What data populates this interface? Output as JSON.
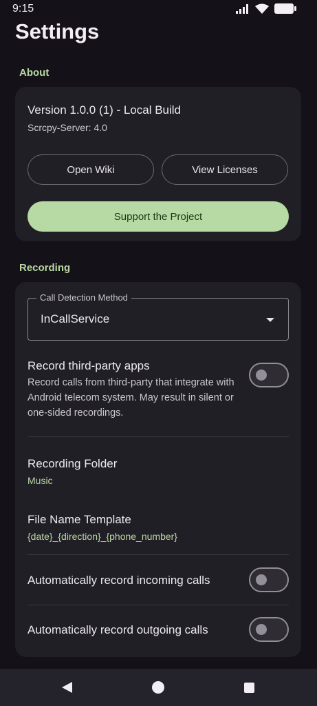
{
  "status_bar": {
    "time": "9:15",
    "icons": [
      "signal-icon",
      "wifi-icon",
      "battery-icon"
    ]
  },
  "page": {
    "title": "Settings"
  },
  "about": {
    "header": "About",
    "version": "Version 1.0.0 (1) - Local Build",
    "server": "Scrcpy-Server: 4.0",
    "open_wiki": "Open Wiki",
    "view_licenses": "View Licenses",
    "support": "Support the Project"
  },
  "recording": {
    "header": "Recording",
    "call_detection_label": "Call Detection Method",
    "call_detection_value": "InCallService",
    "third_party": {
      "title": "Record third-party apps",
      "desc": "Record calls from third-party that integrate with Android telecom system. May result in silent or one-sided recordings.",
      "enabled": false
    },
    "folder": {
      "title": "Recording Folder",
      "value": "Music"
    },
    "template": {
      "title": "File Name Template",
      "value": "{date}_{direction}_{phone_number}"
    },
    "auto_incoming": {
      "title": "Automatically record incoming calls",
      "enabled": false
    },
    "auto_outgoing": {
      "title": "Automatically record outgoing calls",
      "enabled": false
    }
  },
  "colors": {
    "background": "#141218",
    "card": "#211f26",
    "accent": "#b7d9a3",
    "accent_text": "#b9d7a4"
  },
  "nav_bar": {
    "icons": [
      "back-icon",
      "home-icon",
      "recents-icon"
    ]
  }
}
